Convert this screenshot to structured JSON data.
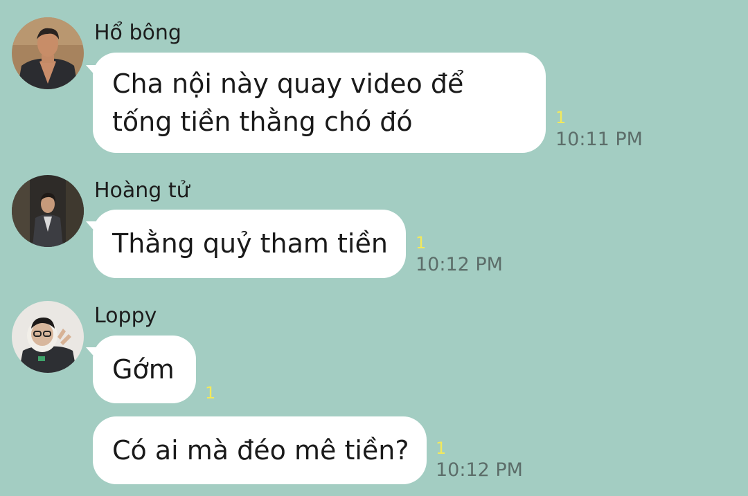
{
  "messages": [
    {
      "sender": "Hổ bông",
      "text": "Cha nội này quay video để tống tiền thằng chó đó",
      "read_count": "1",
      "time": "10:11 PM"
    },
    {
      "sender": "Hoàng tử",
      "text": "Thằng quỷ tham tiền",
      "read_count": "1",
      "time": "10:12 PM"
    },
    {
      "sender": "Loppy",
      "text": "Gớm",
      "read_count": "1",
      "time": ""
    },
    {
      "sender": "",
      "text": "Có ai mà đéo mê tiền?",
      "read_count": "1",
      "time": "10:12 PM"
    }
  ],
  "colors": {
    "background": "#a3cdc2",
    "bubble": "#ffffff",
    "read_indicator": "#f3e95a",
    "timestamp": "#5c6d69"
  },
  "icons": [
    "avatar-hobong",
    "avatar-hoangtu",
    "avatar-loppy"
  ]
}
